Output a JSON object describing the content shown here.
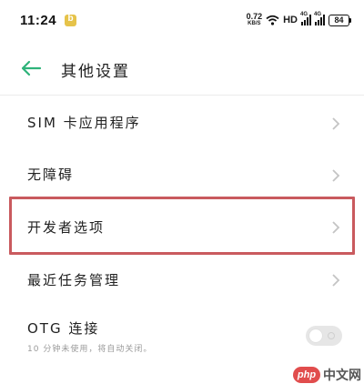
{
  "status_bar": {
    "time": "11:24",
    "notification_badge": "b",
    "net_speed_value": "0.72",
    "net_speed_unit": "KB/S",
    "hd_label": "HD",
    "signal_1_label": "4G",
    "signal_2_label": "4G",
    "battery_level": "84"
  },
  "header": {
    "back_icon": "arrow-left-icon",
    "title": "其他设置",
    "accent_color": "#2fb37a"
  },
  "menu": {
    "items": [
      {
        "label": "SIM 卡应用程序"
      },
      {
        "label": "无障碍"
      },
      {
        "label": "开发者选项"
      },
      {
        "label": "最近任务管理"
      },
      {
        "label": "OTG 连接",
        "subtitle": "10 分钟未使用，将自动关闭。",
        "toggle_on": false
      }
    ],
    "highlight_color": "#c95a5e"
  },
  "watermark": {
    "logo_text": "php",
    "text": "中文网"
  }
}
